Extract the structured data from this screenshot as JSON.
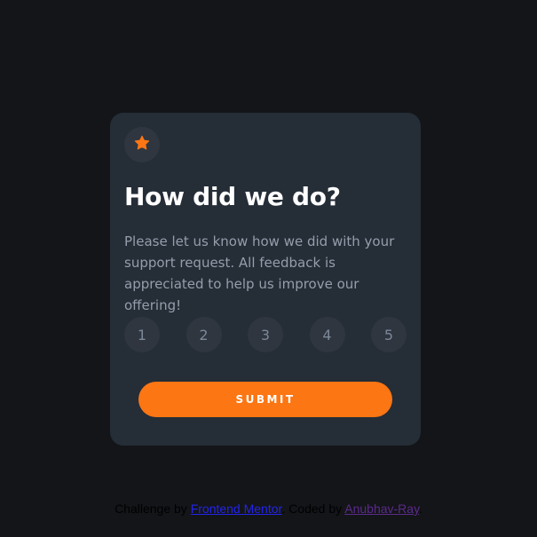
{
  "card": {
    "icon": "star-icon",
    "title": "How did we do?",
    "description": "Please let us know how we did with your support request. All feedback is appreciated to help us improve our offering!",
    "ratings": [
      "1",
      "2",
      "3",
      "4",
      "5"
    ],
    "submit_label": "SUBMIT"
  },
  "attribution": {
    "prefix": "Challenge by ",
    "challenge_link": "Frontend Mentor",
    "middle": ". Coded by ",
    "author_link": "Anubhav-Ray",
    "suffix": "."
  },
  "colors": {
    "background": "#131518",
    "card": "#252d37",
    "accent": "#fc7614",
    "circle": "#2f3640",
    "muted_text": "#959eac"
  }
}
